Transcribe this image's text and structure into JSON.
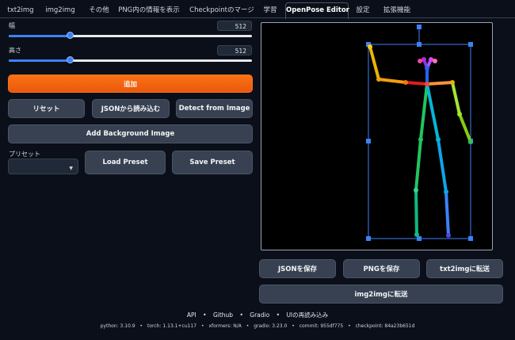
{
  "tabs": [
    {
      "label": "txt2img"
    },
    {
      "label": "img2img"
    },
    {
      "label": "その他"
    },
    {
      "label": "PNG内の情報を表示"
    },
    {
      "label": "Checkpointのマージ"
    },
    {
      "label": "学習"
    },
    {
      "label": "OpenPose Editor"
    },
    {
      "label": "設定"
    },
    {
      "label": "拡張機能"
    }
  ],
  "active_tab": "OpenPose Editor",
  "width_slider": {
    "label": "幅",
    "value": "512",
    "fraction": 0.25
  },
  "height_slider": {
    "label": "高さ",
    "value": "512",
    "fraction": 0.25
  },
  "buttons": {
    "add": "追加",
    "reset": "リセット",
    "load_json": "JSONから読み込む",
    "detect": "Detect from Image",
    "add_background": "Add Background Image",
    "load_preset": "Load Preset",
    "save_preset": "Save Preset",
    "save_json": "JSONを保存",
    "save_png": "PNGを保存",
    "send_txt2img": "txt2imgに転送",
    "send_img2img": "img2imgに転送"
  },
  "preset": {
    "label": "プリセット",
    "value": ""
  },
  "footer": {
    "links": [
      "API",
      "•",
      "Github",
      "•",
      "Gradio",
      "•",
      "UIの再読み込み"
    ],
    "info": [
      "python: 3.10.9",
      "•",
      "torch: 1.13.1+cu117",
      "•",
      "xformers: N/A",
      "•",
      "gradio: 3.23.0",
      "•",
      "commit: 955df775",
      "•",
      "checkpoint: 84a23b651d"
    ]
  },
  "colors": {
    "accent": "#f97316",
    "slider": "#3b82f6",
    "background": "#0b0f19"
  }
}
